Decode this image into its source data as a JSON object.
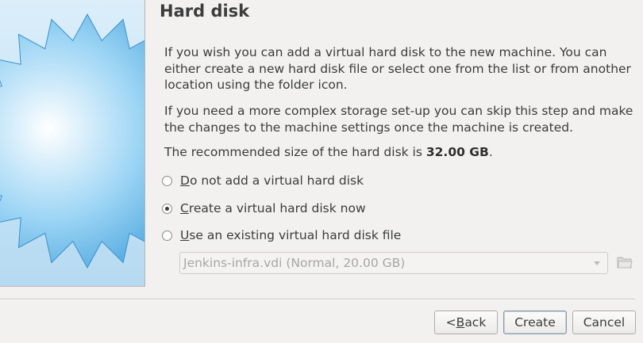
{
  "wizard": {
    "title": "Hard disk",
    "paragraph1": "If you wish you can add a virtual hard disk to the new machine. You can either create a new hard disk file or select one from the list or from another location using the folder icon.",
    "paragraph2": "If you need a more complex storage set-up you can skip this step and make the changes to the machine settings once the machine is created.",
    "recommended_prefix": "The recommended size of the hard disk is ",
    "recommended_size": "32.00 GB",
    "recommended_suffix": "."
  },
  "options": [
    {
      "mnemonic": "D",
      "rest": "o not add a virtual hard disk",
      "checked": false
    },
    {
      "mnemonic": "C",
      "rest": "reate a virtual hard disk now",
      "checked": true
    },
    {
      "mnemonic": "U",
      "rest": "se an existing virtual hard disk file",
      "checked": false
    }
  ],
  "existing_disk_select": {
    "value": "Jenkins-infra.vdi (Normal, 20.00 GB)",
    "enabled": false
  },
  "icons": {
    "side_image": "starburst-wizard-icon",
    "folder": "folder-open-icon",
    "combo_arrow": "chevron-down-icon"
  },
  "buttons": {
    "back_prefix": "< ",
    "back_mnemonic": "B",
    "back_rest": "ack",
    "create": "Create",
    "cancel": "Cancel"
  },
  "colors": {
    "background": "#f2f1f0",
    "starburst": "#6fbde8"
  }
}
